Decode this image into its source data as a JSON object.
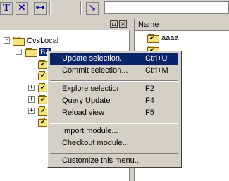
{
  "toolbar": {
    "btn1": "T",
    "btn2": "✕",
    "btn3": "⊶",
    "btn4": "↘"
  },
  "tree": {
    "root_label": "CvsLocal",
    "child_label": "BA"
  },
  "list": {
    "column_header": "Name",
    "items": [
      "aaaa"
    ]
  },
  "menu": {
    "items": [
      {
        "label": "Update selection...",
        "shortcut": "Ctrl+U"
      },
      {
        "label": "Commit selection...",
        "shortcut": "Ctrl+M"
      },
      {
        "label": "Explore selection",
        "shortcut": "F2"
      },
      {
        "label": "Query Update",
        "shortcut": "F4"
      },
      {
        "label": "Reload view",
        "shortcut": "F5"
      },
      {
        "label": "Import module...",
        "shortcut": ""
      },
      {
        "label": "Checkout module...",
        "shortcut": ""
      },
      {
        "label": "Customize this menu...",
        "shortcut": ""
      }
    ]
  },
  "colors": {
    "highlight": "#0a246a",
    "face": "#d4d0c8",
    "folder": "#f6e27a"
  }
}
